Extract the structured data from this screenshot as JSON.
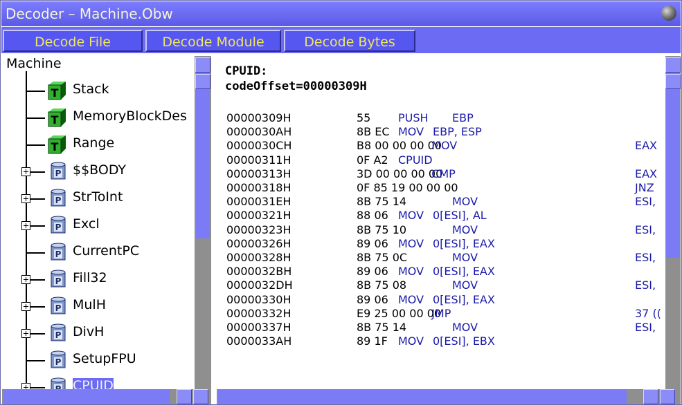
{
  "window": {
    "title": "Decoder – Machine.Obw"
  },
  "toolbar": {
    "buttons": [
      "Decode File",
      "Decode Module",
      "Decode Bytes"
    ]
  },
  "tree": {
    "root": "Machine",
    "items": [
      {
        "label": "Stack",
        "kind": "T",
        "expandable": false
      },
      {
        "label": "MemoryBlockDes",
        "kind": "T",
        "expandable": false
      },
      {
        "label": "Range",
        "kind": "T",
        "expandable": false
      },
      {
        "label": "$$BODY",
        "kind": "P",
        "expandable": true
      },
      {
        "label": "StrToInt",
        "kind": "P",
        "expandable": true
      },
      {
        "label": "Excl",
        "kind": "P",
        "expandable": true
      },
      {
        "label": "CurrentPC",
        "kind": "P",
        "expandable": false
      },
      {
        "label": "Fill32",
        "kind": "P",
        "expandable": true
      },
      {
        "label": "MulH",
        "kind": "P",
        "expandable": true
      },
      {
        "label": "DivH",
        "kind": "P",
        "expandable": true
      },
      {
        "label": "SetupFPU",
        "kind": "P",
        "expandable": false
      },
      {
        "label": "CPUID",
        "kind": "P",
        "expandable": true,
        "selected": true
      }
    ]
  },
  "code": {
    "header": [
      "CPUID:",
      "codeOffset=00000309H"
    ],
    "rows": [
      {
        "addr": "00000309H",
        "bytes": "55",
        "mn": "PUSH",
        "ops": "EBP",
        "ops2": ""
      },
      {
        "addr": "0000030AH",
        "bytes": "8B EC",
        "mn": "MOV",
        "ops": "EBP, ESP",
        "ops2": ""
      },
      {
        "addr": "0000030CH",
        "bytes": "B8 00 00 00 00",
        "mn": "MOV",
        "ops": "",
        "ops2": "EAX"
      },
      {
        "addr": "00000311H",
        "bytes": "0F A2",
        "mn": "CPUID",
        "ops": "",
        "ops2": ""
      },
      {
        "addr": "00000313H",
        "bytes": "3D 00 00 00 00",
        "mn": "CMP",
        "ops": "",
        "ops2": "EAX"
      },
      {
        "addr": "00000318H",
        "bytes": "0F 85 19 00 00 00",
        "mn": "",
        "ops": "",
        "ops2": "JNZ"
      },
      {
        "addr": "0000031EH",
        "bytes": "8B 75 14",
        "mn": "MOV",
        "ops": "",
        "ops2": "ESI,"
      },
      {
        "addr": "00000321H",
        "bytes": "88 06",
        "mn": "MOV",
        "ops": "0[ESI], AL",
        "ops2": ""
      },
      {
        "addr": "00000323H",
        "bytes": "8B 75 10",
        "mn": "MOV",
        "ops": "",
        "ops2": "ESI,"
      },
      {
        "addr": "00000326H",
        "bytes": "89 06",
        "mn": "MOV",
        "ops": "0[ESI], EAX",
        "ops2": ""
      },
      {
        "addr": "00000328H",
        "bytes": "8B 75 0C",
        "mn": "MOV",
        "ops": "",
        "ops2": "ESI,"
      },
      {
        "addr": "0000032BH",
        "bytes": "89 06",
        "mn": "MOV",
        "ops": "0[ESI], EAX",
        "ops2": ""
      },
      {
        "addr": "0000032DH",
        "bytes": "8B 75 08",
        "mn": "MOV",
        "ops": "",
        "ops2": "ESI,"
      },
      {
        "addr": "00000330H",
        "bytes": "89 06",
        "mn": "MOV",
        "ops": "0[ESI], EAX",
        "ops2": ""
      },
      {
        "addr": "00000332H",
        "bytes": "E9 25 00 00 00",
        "mn": "JMP",
        "ops": "",
        "ops2": "37 (("
      },
      {
        "addr": "00000337H",
        "bytes": "8B 75 14",
        "mn": "MOV",
        "ops": "",
        "ops2": "ESI,"
      },
      {
        "addr": "0000033AH",
        "bytes": "89 1F",
        "mn": "MOV",
        "ops": "0[ESI], EBX",
        "ops2": ""
      }
    ]
  },
  "colors": {
    "title_bg": "#6b6bf4",
    "button_text": "#f0e860",
    "code_blue": "#1a1aa8"
  }
}
